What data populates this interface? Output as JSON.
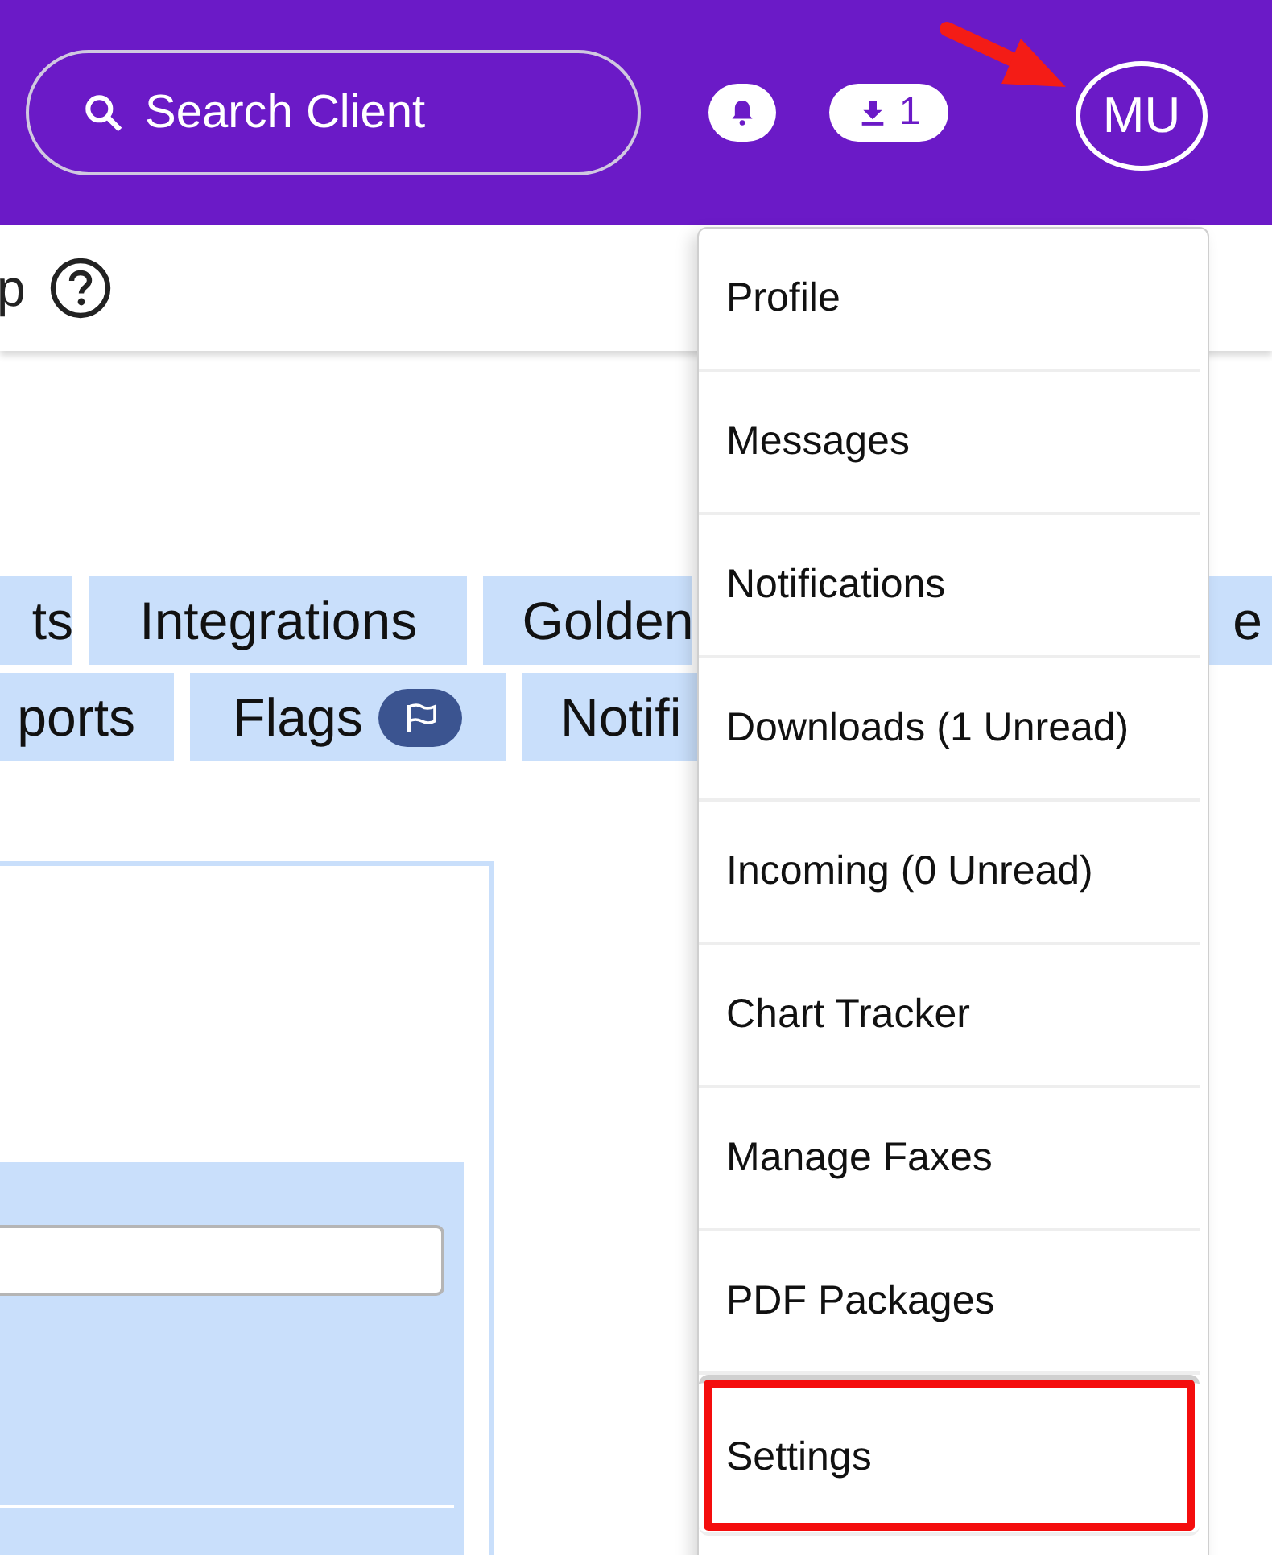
{
  "header": {
    "search": {
      "placeholder": "Search Client"
    },
    "notifications": {
      "kind": "bell"
    },
    "downloads": {
      "count": "1"
    },
    "avatar": {
      "initials": "MU"
    }
  },
  "subheader": {
    "title": "p"
  },
  "tab_rows": [
    {
      "tabs": [
        {
          "label": "ts",
          "kind": "plain"
        },
        {
          "label": "Integrations",
          "kind": "plain"
        },
        {
          "label": "Golden",
          "kind": "plain"
        },
        {
          "label": "e",
          "kind": "plain"
        }
      ]
    },
    {
      "tabs": [
        {
          "label": "ports",
          "kind": "plain"
        },
        {
          "label": "Flags",
          "kind": "flagged"
        },
        {
          "label": "Notifi",
          "kind": "plain"
        }
      ]
    }
  ],
  "user_menu": {
    "items": [
      {
        "label": "Profile",
        "highlighted": false
      },
      {
        "label": "Messages",
        "highlighted": false
      },
      {
        "label": "Notifications",
        "highlighted": false
      },
      {
        "label": "Downloads (1 Unread)",
        "highlighted": false
      },
      {
        "label": "Incoming (0 Unread)",
        "highlighted": false
      },
      {
        "label": "Chart Tracker",
        "highlighted": false
      },
      {
        "label": "Manage Faxes",
        "highlighted": false
      },
      {
        "label": "PDF Packages",
        "highlighted": false
      },
      {
        "label": "Settings",
        "highlighted": true
      }
    ]
  }
}
